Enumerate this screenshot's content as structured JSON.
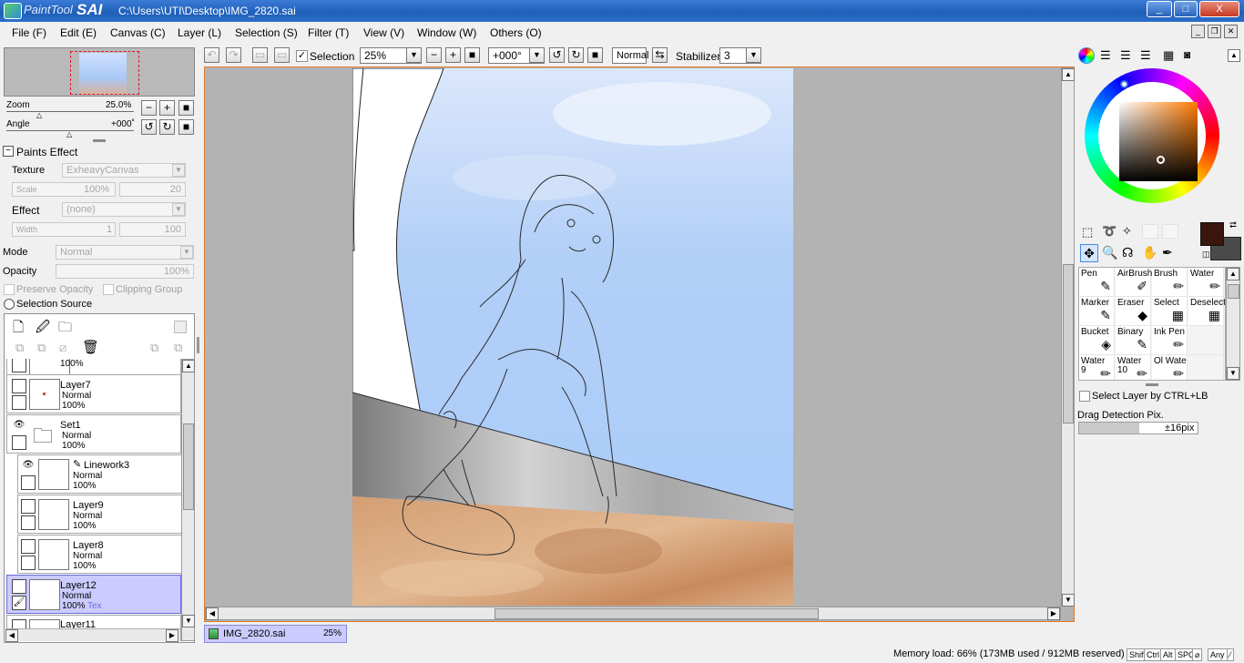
{
  "window": {
    "brand_italic": "PaintTool",
    "brand_bold": "SAI",
    "path": "C:\\Users\\UTI\\Desktop\\IMG_2820.sai",
    "minimize": "_",
    "maximize": "□",
    "close": "X"
  },
  "menu": [
    "File (F)",
    "Edit (E)",
    "Canvas (C)",
    "Layer (L)",
    "Selection (S)",
    "Filter (T)",
    "View (V)",
    "Window (W)",
    "Others (O)"
  ],
  "navigator": {
    "zoom_label": "Zoom",
    "zoom_value": "25.0%",
    "angle_label": "Angle",
    "angle_value": "+000˚"
  },
  "paints_effect": {
    "header": "Paints Effect",
    "texture_label": "Texture",
    "texture_value": "ExheavyCanvas",
    "scale_label": "Scale",
    "scale_value": "100%",
    "scale_strength": "20",
    "effect_label": "Effect",
    "effect_value": "(none)",
    "width_label": "Width",
    "width_value": "1",
    "width_strength": "100"
  },
  "blend": {
    "mode_label": "Mode",
    "mode_value": "Normal",
    "opacity_label": "Opacity",
    "opacity_value": "100%",
    "preserve_opacity": "Preserve Opacity",
    "clipping_group": "Clipping Group",
    "selection_source": "Selection Source"
  },
  "layers": [
    {
      "name": "",
      "mode": "",
      "opacity": "100%",
      "visible": false,
      "indent": false,
      "selected": false,
      "folder": false,
      "partial": true
    },
    {
      "name": "Layer7",
      "mode": "Normal",
      "opacity": "100%",
      "visible": false,
      "indent": false,
      "selected": false,
      "folder": false
    },
    {
      "name": "Set1",
      "mode": "Normal",
      "opacity": "100%",
      "visible": true,
      "indent": false,
      "selected": false,
      "folder": true
    },
    {
      "name": "Linework3",
      "mode": "Normal",
      "opacity": "100%",
      "visible": true,
      "indent": true,
      "selected": false,
      "folder": false,
      "linework": true
    },
    {
      "name": "Layer9",
      "mode": "Normal",
      "opacity": "100%",
      "visible": false,
      "indent": true,
      "selected": false,
      "folder": false
    },
    {
      "name": "Layer8",
      "mode": "Normal",
      "opacity": "100%",
      "visible": false,
      "indent": true,
      "selected": false,
      "folder": false
    },
    {
      "name": "Layer12",
      "mode": "Normal",
      "opacity": "100%",
      "extra": "Tex",
      "visible": false,
      "indent": true,
      "selected": true,
      "folder": false
    },
    {
      "name": "Layer11",
      "mode": "",
      "opacity": "",
      "visible": false,
      "indent": false,
      "selected": false,
      "folder": false
    }
  ],
  "toolbar": {
    "selection_label": "Selection",
    "zoom_value": "25%",
    "angle_value": "+000°",
    "blend_value": "Normal",
    "stabilizer_label": "Stabilizer",
    "stabilizer_value": "3"
  },
  "colors": {
    "primary": "#3a160c",
    "secondary": "#4a4a4a",
    "accent_selection": "#cbcbff",
    "canvas_border": "#e07a2a"
  },
  "tools": [
    {
      "name": "Pen",
      "sub": "",
      "icon": "pen-icon",
      "glyph": "✎"
    },
    {
      "name": "AirBrush",
      "sub": "",
      "icon": "airbrush-icon",
      "glyph": "✐"
    },
    {
      "name": "Brush",
      "sub": "",
      "icon": "brush-icon",
      "glyph": "✏"
    },
    {
      "name": "Water",
      "sub": "",
      "icon": "water-icon",
      "glyph": "✏"
    },
    {
      "name": "Marker",
      "sub": "",
      "icon": "marker-icon",
      "glyph": "✎"
    },
    {
      "name": "Eraser",
      "sub": "",
      "icon": "eraser-icon",
      "glyph": "◆"
    },
    {
      "name": "Select",
      "sub": "",
      "icon": "select-tool-icon",
      "glyph": "▦"
    },
    {
      "name": "Deselect",
      "sub": "",
      "icon": "deselect-tool-icon",
      "glyph": "▦"
    },
    {
      "name": "Bucket",
      "sub": "",
      "icon": "bucket-icon",
      "glyph": "◈"
    },
    {
      "name": "Binary",
      "sub": "",
      "icon": "binary-pen-icon",
      "glyph": "✎"
    },
    {
      "name": "Ink Pen",
      "sub": "",
      "icon": "ink-pen-icon",
      "glyph": "✏"
    },
    {
      "name": "",
      "sub": "",
      "icon": "",
      "glyph": ""
    },
    {
      "name": "Water",
      "sub": "9",
      "icon": "water-icon",
      "glyph": "✏"
    },
    {
      "name": "Water",
      "sub": "10",
      "icon": "water-icon",
      "glyph": "✏"
    },
    {
      "name": "Ol Wate",
      "sub": "",
      "icon": "oil-water-icon",
      "glyph": "✏"
    },
    {
      "name": "",
      "sub": "",
      "icon": "",
      "glyph": ""
    }
  ],
  "options": {
    "select_layer_ctrl": "Select Layer by CTRL+LB",
    "drag_detection_label": "Drag Detection Pix.",
    "drag_detection_value": "±16pix"
  },
  "document_tab": {
    "name": "IMG_2820.sai",
    "zoom": "25%"
  },
  "status": {
    "memory": "Memory load: 66% (173MB used / 912MB reserved)",
    "keys": [
      "Shift",
      "Ctrl",
      "Alt",
      "SPC",
      "⌀",
      "Any",
      "⁄"
    ]
  }
}
